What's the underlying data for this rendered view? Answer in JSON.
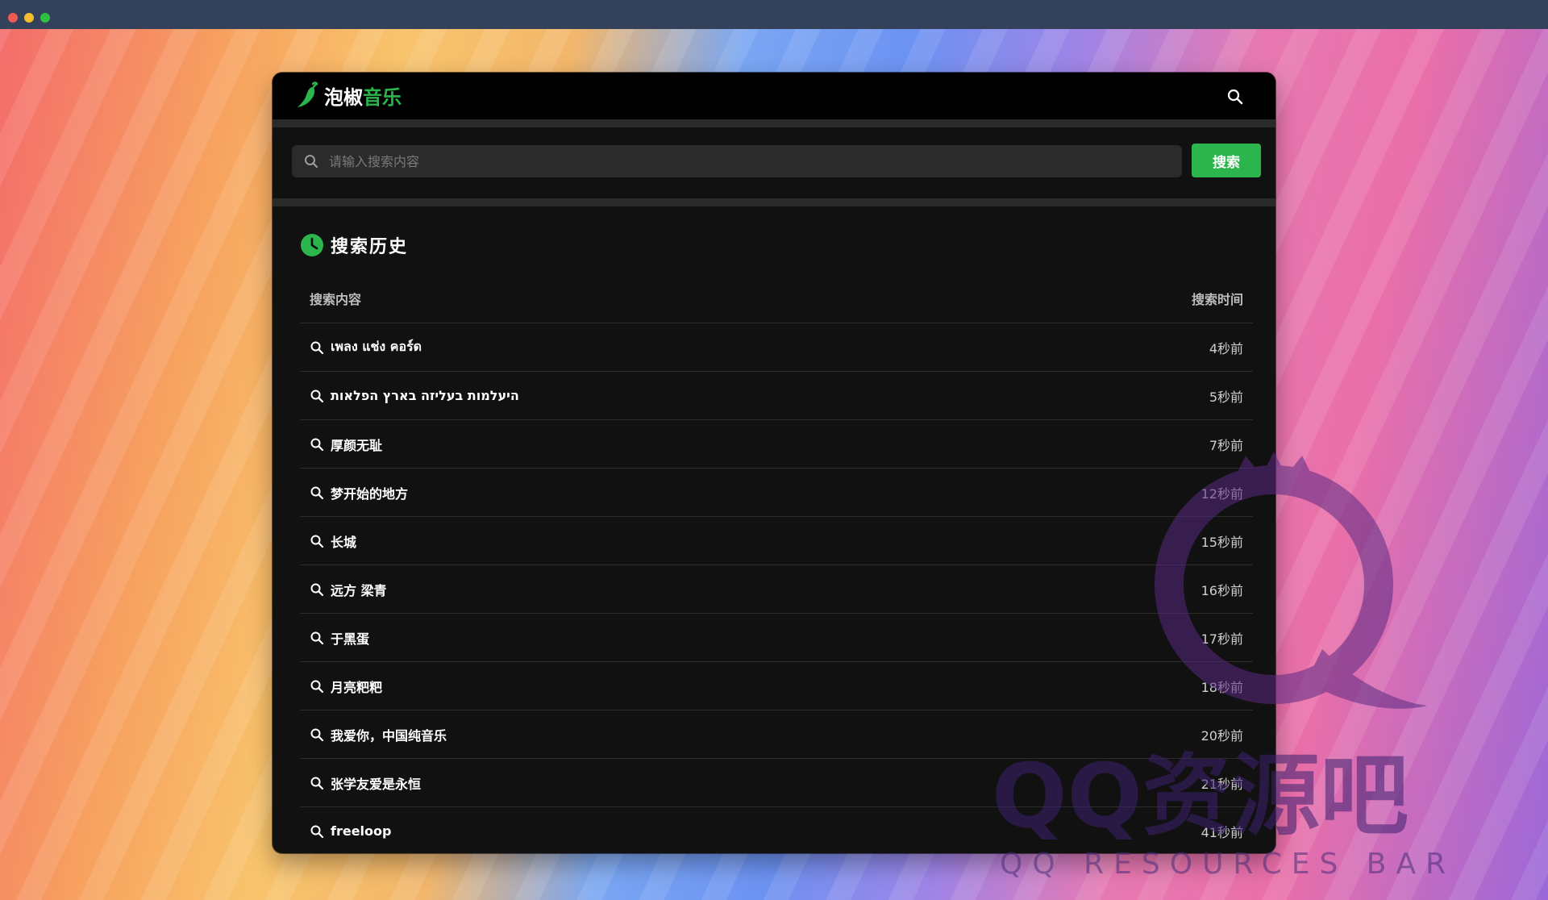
{
  "app": {
    "name_part1": "泡椒",
    "name_part2": "音乐"
  },
  "search": {
    "placeholder": "请输入搜索内容",
    "button_label": "搜索"
  },
  "history": {
    "title": "搜索历史",
    "columns": [
      "搜索内容",
      "搜索时间"
    ],
    "rows": [
      {
        "query": "เพลง แช่ง คอร์ด",
        "time": "4秒前"
      },
      {
        "query": "היעלמות בעליזה בארץ הפלאות",
        "time": "5秒前"
      },
      {
        "query": "厚颜无耻",
        "time": "7秒前"
      },
      {
        "query": "梦开始的地方",
        "time": "12秒前"
      },
      {
        "query": "长城",
        "time": "15秒前"
      },
      {
        "query": "远方 梁青",
        "time": "16秒前"
      },
      {
        "query": "于黑蛋",
        "time": "17秒前"
      },
      {
        "query": "月亮粑粑",
        "time": "18秒前"
      },
      {
        "query": "我爱你，中国纯音乐",
        "time": "20秒前"
      },
      {
        "query": "张学友爱是永恒",
        "time": "21秒前"
      },
      {
        "query": "freeloop",
        "time": "41秒前"
      }
    ]
  },
  "watermark": {
    "main_text": "QQ资源吧",
    "sub_text": "QQ RESOURCES BAR"
  },
  "icons": {
    "logo": "chili-pepper-icon",
    "header_search": "search-icon",
    "input_search": "search-icon",
    "history": "clock-icon",
    "row": "search-icon"
  },
  "colors": {
    "accent": "#2bb54c",
    "panel_bg": "#111111",
    "header_bg": "#000000",
    "input_bg": "#2b2b2b"
  }
}
